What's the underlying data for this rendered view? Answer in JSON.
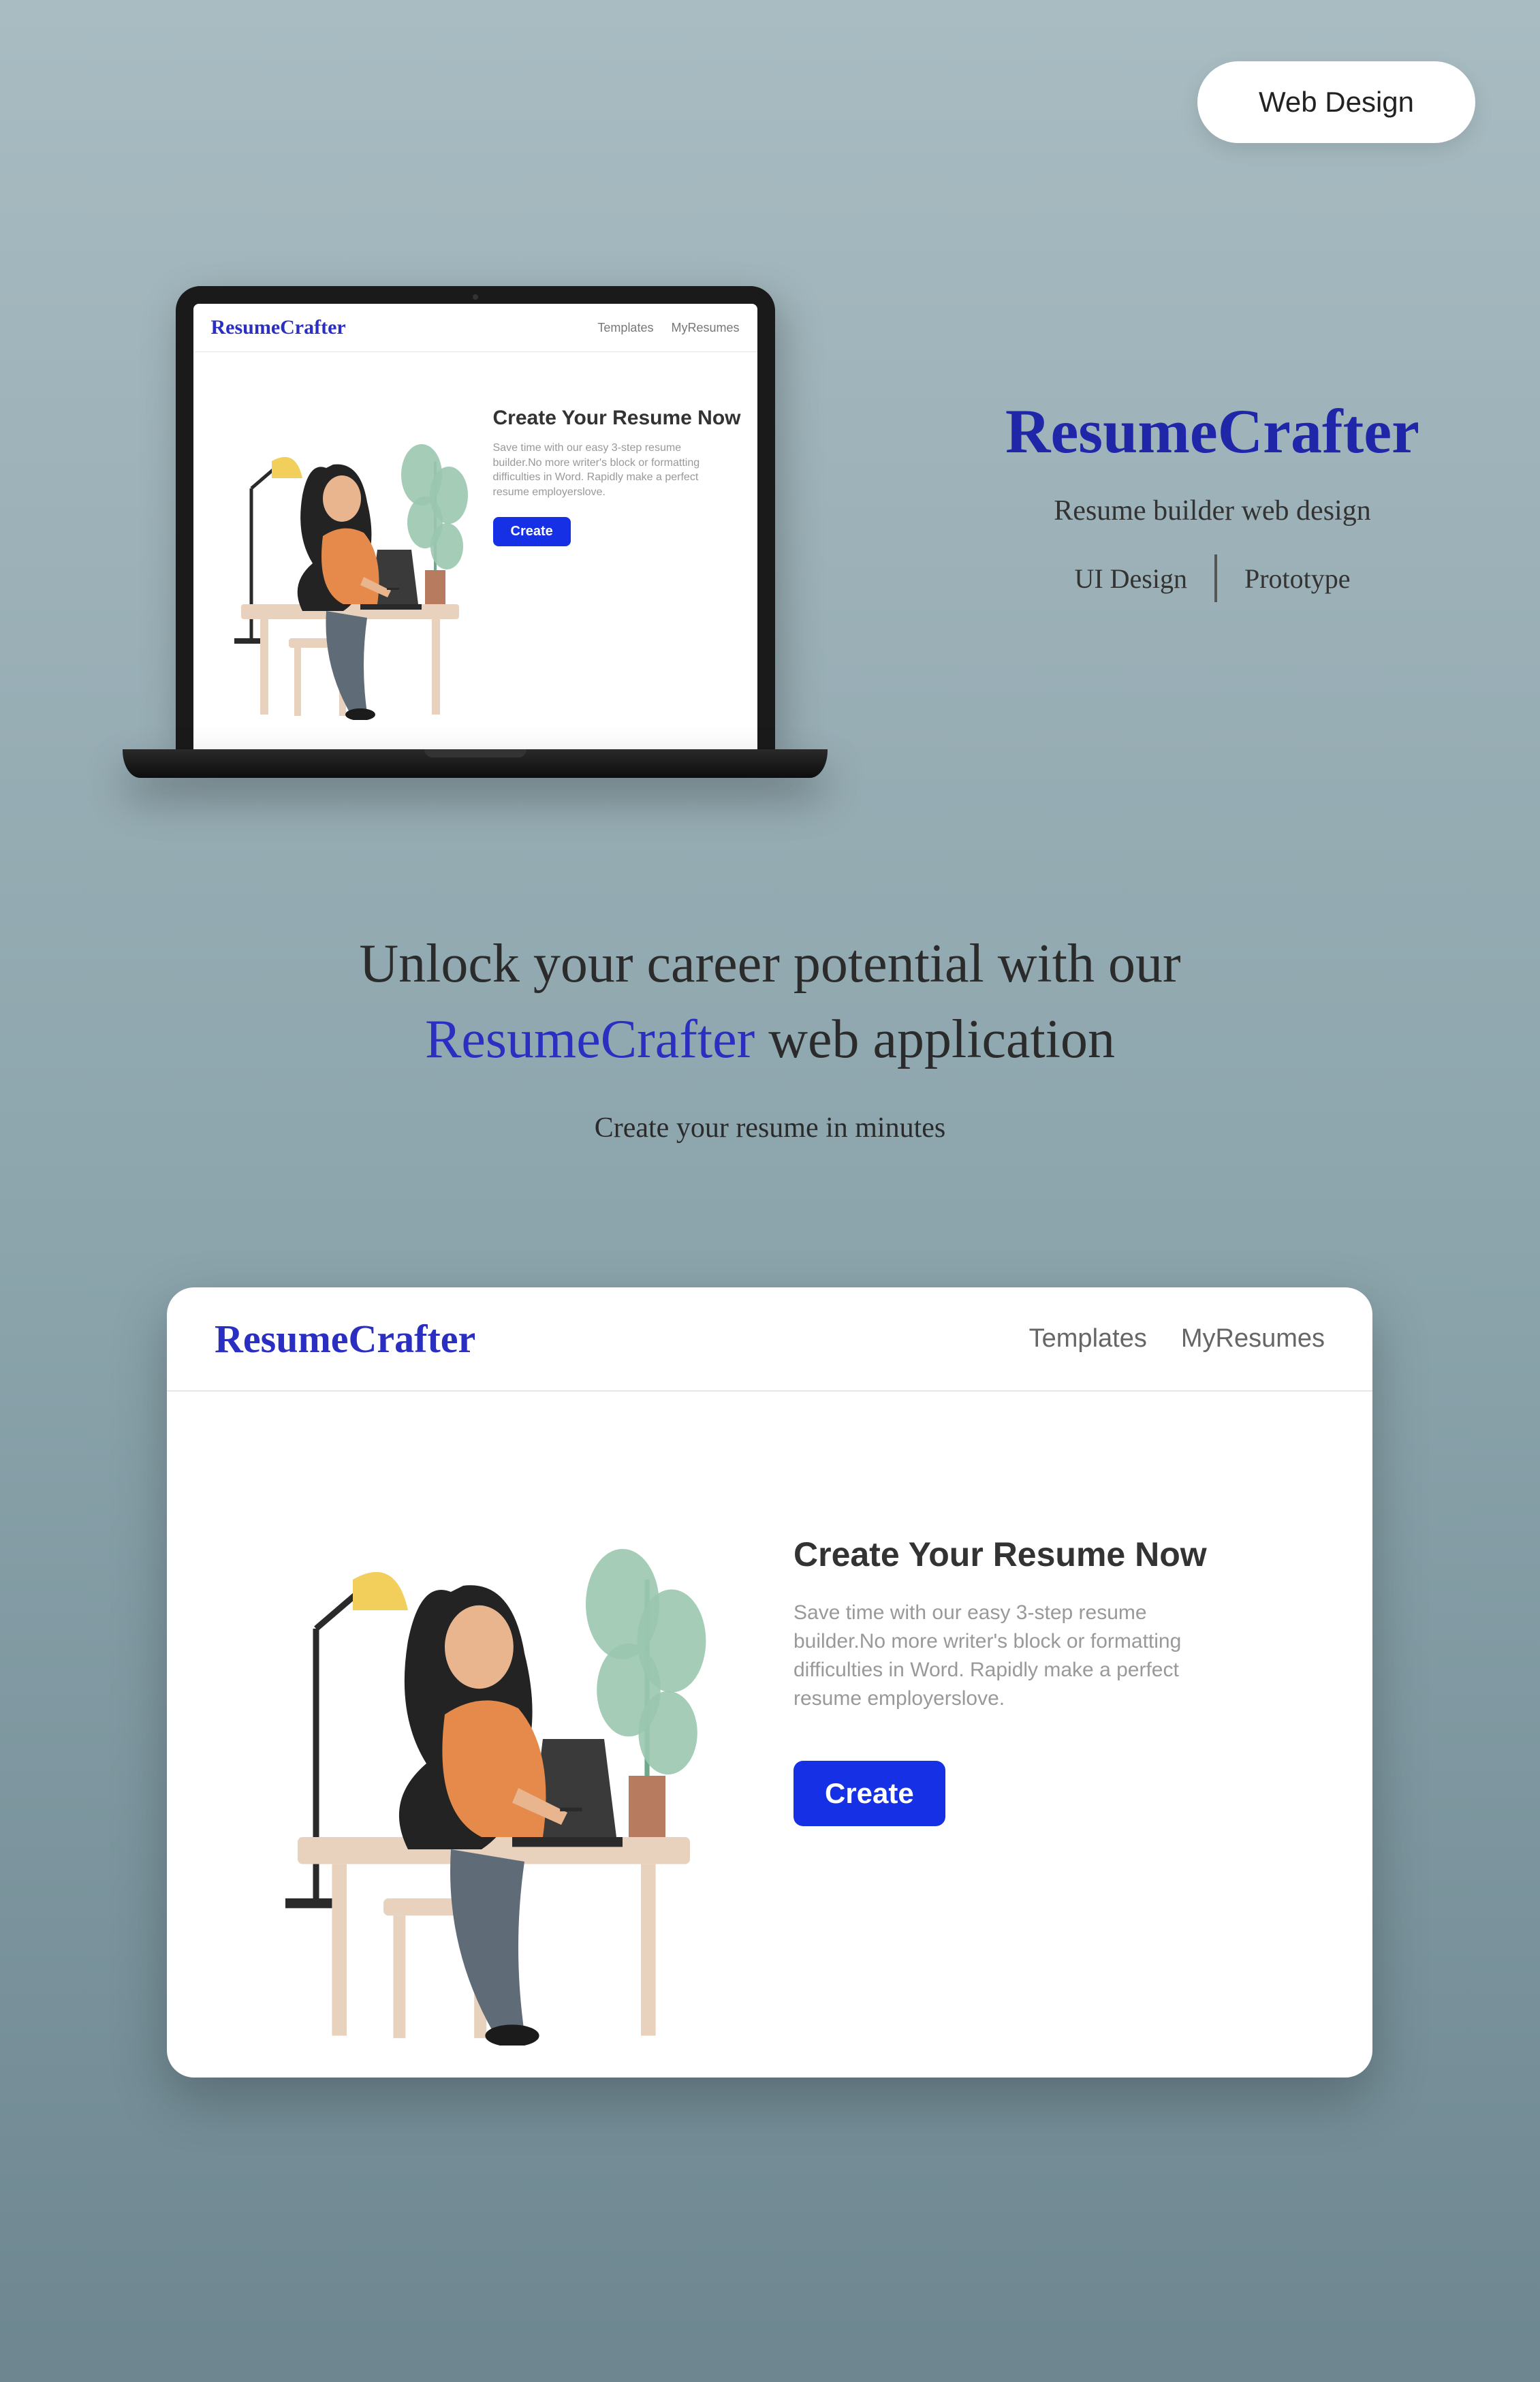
{
  "pill": {
    "label": "Web Design"
  },
  "app": {
    "logo": "ResumeCrafter",
    "nav": {
      "templates": "Templates",
      "myresumes": "MyResumes"
    },
    "hero": {
      "title": "Create Your Resume Now",
      "body": "Save time with our easy 3-step resume builder.No more writer's block or formatting difficulties in Word. Rapidly make a perfect resume employerslove.",
      "cta": "Create"
    }
  },
  "right": {
    "title": "ResumeCrafter",
    "subtitle": "Resume builder web design",
    "tag1": "UI Design",
    "tag2": "Prototype"
  },
  "tagline": {
    "line1": "Unlock your career potential with our",
    "accent": "ResumeCrafter",
    "line2_rest": " web application",
    "line3": "Create your resume in minutes"
  }
}
